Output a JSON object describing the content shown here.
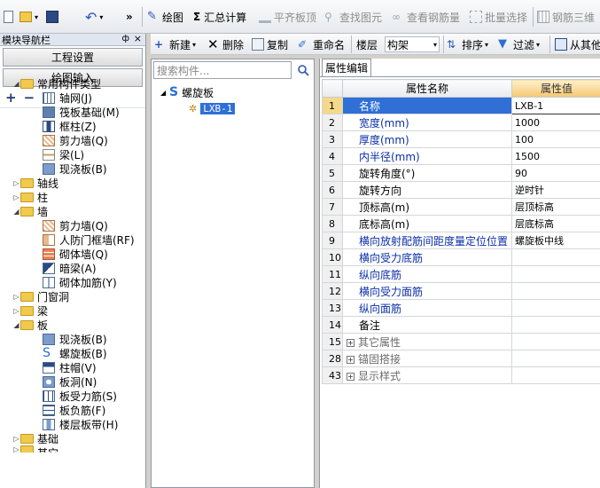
{
  "toolbar": {
    "overflow": "»",
    "draw": "绘图",
    "sum_calc": "汇总计算",
    "flat_slab_top": "平齐板顶",
    "find_element": "查找图元",
    "view_rebar": "查看钢筋量",
    "batch_select": "批量选择",
    "rebar_3d": "钢筋三维"
  },
  "left_nav": {
    "title": "模块导航栏",
    "pin": "ф",
    "close": "×",
    "project_settings": "工程设置",
    "drawing_input": "绘图输入",
    "add_glyph": "+",
    "remove_glyph": "−"
  },
  "tree": {
    "common": {
      "label": "常用构件类型",
      "children": [
        "轴网(J)",
        "筏板基础(M)",
        "框柱(Z)",
        "剪力墙(Q)",
        "梁(L)",
        "现浇板(B)"
      ]
    },
    "axis": "轴线",
    "column": "柱",
    "wall": {
      "label": "墙",
      "children": [
        "剪力墙(Q)",
        "人防门框墙(RF)",
        "砌体墙(Q)",
        "暗梁(A)",
        "砌体加筋(Y)"
      ]
    },
    "door_window": "门窗洞",
    "beam": "梁",
    "slab": {
      "label": "板",
      "children": [
        "现浇板(B)",
        "螺旋板(B)",
        "柱帽(V)",
        "板洞(N)",
        "板受力筋(S)",
        "板负筋(F)",
        "楼层板带(H)"
      ]
    },
    "foundation": "基础",
    "other": "其它"
  },
  "sec_toolbar": {
    "new": "新建",
    "delete": "删除",
    "copy": "复制",
    "rename": "重命名",
    "floor_label": "楼层",
    "floor_value": "构架",
    "sort": "排序",
    "filter": "过滤",
    "from_other": "从其他"
  },
  "mid": {
    "search_placeholder": "搜索构件...",
    "root": "螺旋板",
    "item": "LXB-1"
  },
  "props": {
    "tab": "属性编辑",
    "header_name": "属性名称",
    "header_value": "属性值",
    "rows": [
      {
        "n": "1",
        "name": "名称",
        "value": "LXB-1"
      },
      {
        "n": "2",
        "name": "宽度(mm)",
        "value": "1000"
      },
      {
        "n": "3",
        "name": "厚度(mm)",
        "value": "100"
      },
      {
        "n": "4",
        "name": "内半径(mm)",
        "value": "1500"
      },
      {
        "n": "5",
        "name": "旋转角度(°)",
        "value": "90"
      },
      {
        "n": "6",
        "name": "旋转方向",
        "value": "逆时针"
      },
      {
        "n": "7",
        "name": "顶标高(m)",
        "value": "层顶标高"
      },
      {
        "n": "8",
        "name": "底标高(m)",
        "value": "层底标高"
      },
      {
        "n": "9",
        "name": "横向放射配筋间距度量定位位置",
        "value": "螺旋板中线"
      },
      {
        "n": "10",
        "name": "横向受力底筋",
        "value": ""
      },
      {
        "n": "11",
        "name": "纵向底筋",
        "value": ""
      },
      {
        "n": "12",
        "name": "横向受力面筋",
        "value": ""
      },
      {
        "n": "13",
        "name": "纵向面筋",
        "value": ""
      },
      {
        "n": "14",
        "name": "备注",
        "value": ""
      },
      {
        "n": "15",
        "name": "其它属性",
        "value": ""
      },
      {
        "n": "28",
        "name": "锚固搭接",
        "value": ""
      },
      {
        "n": "43",
        "name": "显示样式",
        "value": ""
      }
    ]
  }
}
